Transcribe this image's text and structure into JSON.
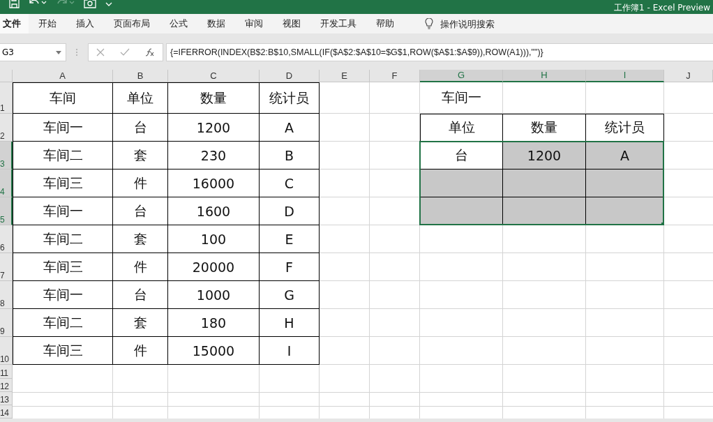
{
  "title_bar": {
    "title": "工作簿1 - Excel Preview"
  },
  "ribbon_tabs": [
    {
      "label": "文件",
      "kind": "file",
      "selected": false
    },
    {
      "label": "开始",
      "kind": "tab",
      "selected": false
    },
    {
      "label": "插入",
      "kind": "tab",
      "selected": false
    },
    {
      "label": "页面布局",
      "kind": "tab",
      "selected": false
    },
    {
      "label": "公式",
      "kind": "tab",
      "selected": false
    },
    {
      "label": "数据",
      "kind": "tab",
      "selected": false
    },
    {
      "label": "审阅",
      "kind": "tab",
      "selected": false
    },
    {
      "label": "视图",
      "kind": "tab",
      "selected": false
    },
    {
      "label": "开发工具",
      "kind": "tab",
      "selected": false
    },
    {
      "label": "帮助",
      "kind": "tab",
      "selected": false
    }
  ],
  "tell_me": {
    "placeholder": "操作说明搜索"
  },
  "name_box": {
    "value": "G3"
  },
  "formula_bar": {
    "value": "{=IFERROR(INDEX(B$2:B$10,SMALL(IF($A$2:$A$10=$G$1,ROW($A$1:$A$9)),ROW(A1))),\"\")}"
  },
  "columns": [
    {
      "label": "A",
      "selected": false
    },
    {
      "label": "B",
      "selected": false
    },
    {
      "label": "C",
      "selected": false
    },
    {
      "label": "D",
      "selected": false
    },
    {
      "label": "E",
      "selected": false
    },
    {
      "label": "F",
      "selected": false
    },
    {
      "label": "G",
      "selected": true
    },
    {
      "label": "H",
      "selected": true
    },
    {
      "label": "I",
      "selected": true
    },
    {
      "label": "J",
      "selected": false
    }
  ],
  "rows": [
    {
      "label": "1",
      "selected": false
    },
    {
      "label": "2",
      "selected": false
    },
    {
      "label": "3",
      "selected": true
    },
    {
      "label": "4",
      "selected": true
    },
    {
      "label": "5",
      "selected": true
    },
    {
      "label": "6",
      "selected": false
    },
    {
      "label": "7",
      "selected": false
    },
    {
      "label": "8",
      "selected": false
    },
    {
      "label": "9",
      "selected": false
    },
    {
      "label": "10",
      "selected": false
    },
    {
      "label": "11",
      "selected": false
    },
    {
      "label": "12",
      "selected": false
    },
    {
      "label": "13",
      "selected": false
    },
    {
      "label": "14",
      "selected": false
    }
  ],
  "source_table": {
    "columns": [
      "车间",
      "单位",
      "数量",
      "统计员"
    ],
    "rows": [
      [
        "车间一",
        "台",
        "1200",
        "A"
      ],
      [
        "车间二",
        "套",
        "230",
        "B"
      ],
      [
        "车间三",
        "件",
        "16000",
        "C"
      ],
      [
        "车间一",
        "台",
        "1600",
        "D"
      ],
      [
        "车间二",
        "套",
        "100",
        "E"
      ],
      [
        "车间三",
        "件",
        "20000",
        "F"
      ],
      [
        "车间一",
        "台",
        "1000",
        "G"
      ],
      [
        "车间二",
        "套",
        "180",
        "H"
      ],
      [
        "车间三",
        "件",
        "15000",
        "I"
      ]
    ]
  },
  "lookup": {
    "criterion": "车间一",
    "columns": [
      "单位",
      "数量",
      "统计员"
    ],
    "rows": [
      [
        {
          "text": "台",
          "selected": true,
          "active": true
        },
        {
          "text": "1200",
          "selected": true,
          "active": false
        },
        {
          "text": "A",
          "selected": true,
          "active": false
        }
      ],
      [
        {
          "selected": true,
          "active": false
        },
        {
          "selected": true,
          "active": false
        },
        {
          "selected": true,
          "active": false
        }
      ],
      [
        {
          "selected": true,
          "active": false
        },
        {
          "selected": true,
          "active": false
        },
        {
          "selected": true,
          "active": false
        }
      ]
    ]
  }
}
